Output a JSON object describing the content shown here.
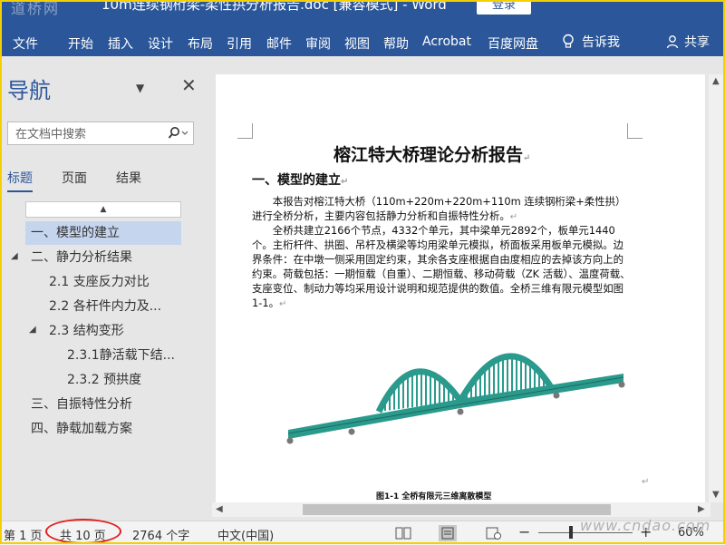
{
  "window": {
    "watermark_logo": "道桥网",
    "title": "10m连续钢桁梁-柔性拱分析报告.doc [兼容模式] - Word",
    "login": "登录"
  },
  "ribbon": {
    "tabs": [
      "文件",
      "开始",
      "插入",
      "设计",
      "布局",
      "引用",
      "邮件",
      "审阅",
      "视图",
      "帮助",
      "Acrobat",
      "百度网盘"
    ],
    "tell_me": "告诉我",
    "share": "共享"
  },
  "nav": {
    "title": "导航",
    "search_placeholder": "在文档中搜索",
    "tabs": [
      "标题",
      "页面",
      "结果"
    ],
    "items": [
      "一、模型的建立",
      "二、静力分析结果",
      "2.1 支座反力对比",
      "2.2 各杆件内力及...",
      "2.3 结构变形",
      "2.3.1静活载下结...",
      "2.3.2 预拱度",
      "三、自振特性分析",
      "四、静载加载方案"
    ]
  },
  "document": {
    "title": "榕江特大桥理论分析报告",
    "heading1": "一、模型的建立",
    "para1": "本报告对榕江特大桥（110m+220m+220m+110m 连续钢桁梁+柔性拱）进行全桥分析，主要内容包括静力分析和自振特性分析。",
    "para2": "全桥共建立2166个节点，4332个单元，其中梁单元2892个，板单元1440个。主桁杆件、拱圈、吊杆及横梁等均用梁单元模拟，桥面板采用板单元模拟。边界条件：在中墩一侧采用固定约束，其余各支座根据自由度相应的去掉该方向上的约束。荷载包括：一期恒载（自重）、二期恒载、移动荷载（ZK 活载）、温度荷载、支座变位、制动力等均采用设计说明和规范提供的数值。全桥三维有限元模型如图1-1。",
    "caption": "图1-1  全桥有限元三维离散模型"
  },
  "status": {
    "page": "第 1 页",
    "total": "共 10 页",
    "words": "2764 个字",
    "lang": "中文(中国)",
    "zoom": "60%",
    "site_watermark": "www.cndao.com"
  },
  "colors": {
    "accent": "#2b579a",
    "model": "#2a9a8c",
    "highlight": "#e02020"
  }
}
